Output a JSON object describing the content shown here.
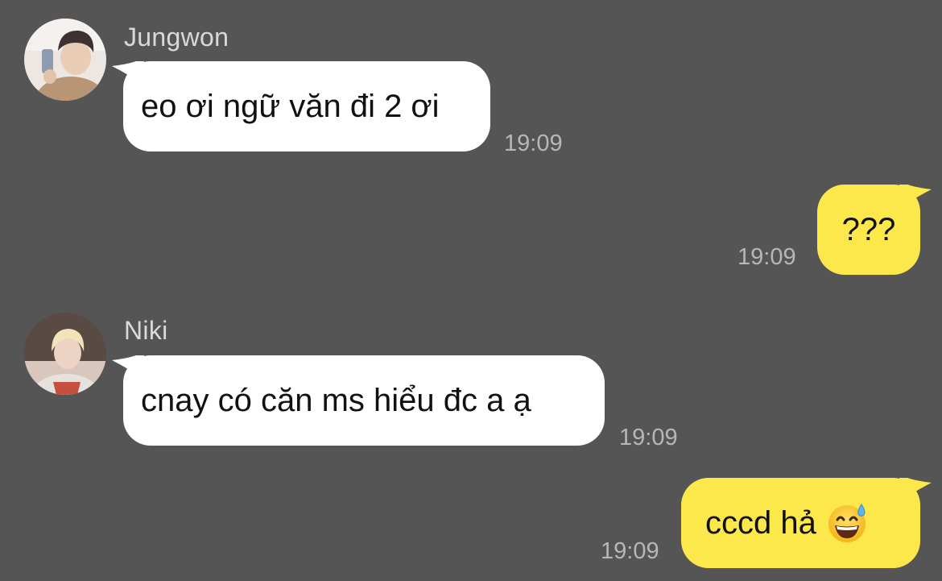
{
  "messages": [
    {
      "sender": "Jungwon",
      "text": "eo ơi ngữ văn đi 2 ơi",
      "time": "19:09",
      "direction": "incoming",
      "avatar_icon": "jungwon-avatar"
    },
    {
      "text": "???",
      "time": "19:09",
      "direction": "outgoing"
    },
    {
      "sender": "Niki",
      "text": "cnay có căn ms hiểu đc a ạ",
      "time": "19:09",
      "direction": "incoming",
      "avatar_icon": "niki-avatar"
    },
    {
      "text": "cccd hả",
      "emoji": "grinning-face-with-sweat-icon",
      "time": "19:09",
      "direction": "outgoing"
    }
  ],
  "colors": {
    "background": "#565556",
    "incoming_bubble": "#ffffff",
    "outgoing_bubble": "#fde84c",
    "sender_name": "#d9d9d9",
    "timestamp": "#b7b7b7"
  }
}
